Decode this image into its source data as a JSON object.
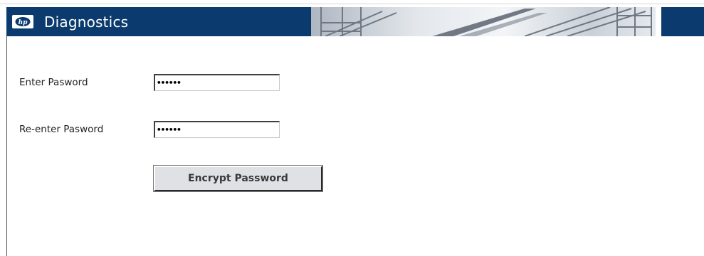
{
  "header": {
    "title": "Diagnostics",
    "logo_icon": "hp-logo-icon",
    "background_color": "#0b3b6e"
  },
  "form": {
    "password_label": "Enter Pasword",
    "password_value": "••••••",
    "reenter_label": "Re-enter Pasword",
    "reenter_value": "••••••",
    "encrypt_button_label": "Encrypt Password"
  }
}
